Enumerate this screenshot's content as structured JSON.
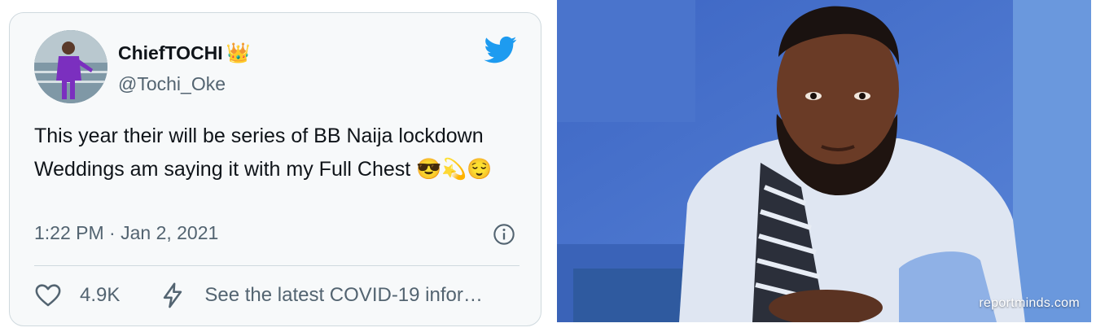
{
  "tweet": {
    "display_name": "ChiefTOCHI",
    "name_emoji": "👑",
    "handle": "@Tochi_Oke",
    "text": "This year their will be series of BB Naija lockdown Weddings am saying it with my Full Chest",
    "text_emojis": "😎💫😌",
    "timestamp": "1:22 PM · Jan 2, 2021",
    "likes": "4.9K",
    "covid_link": "See the latest COVID-19 infor…",
    "icons": {
      "brand": "twitter-bird-icon",
      "info": "info-icon",
      "like": "heart-icon",
      "covid": "lightning-bolt-icon"
    },
    "colors": {
      "brand": "#1d9bf0",
      "card_bg": "#f7f9fa",
      "border": "#cfd9de",
      "secondary_text": "#536471",
      "primary_text": "#0f1419"
    }
  },
  "photo": {
    "watermark": "reportminds.com"
  }
}
